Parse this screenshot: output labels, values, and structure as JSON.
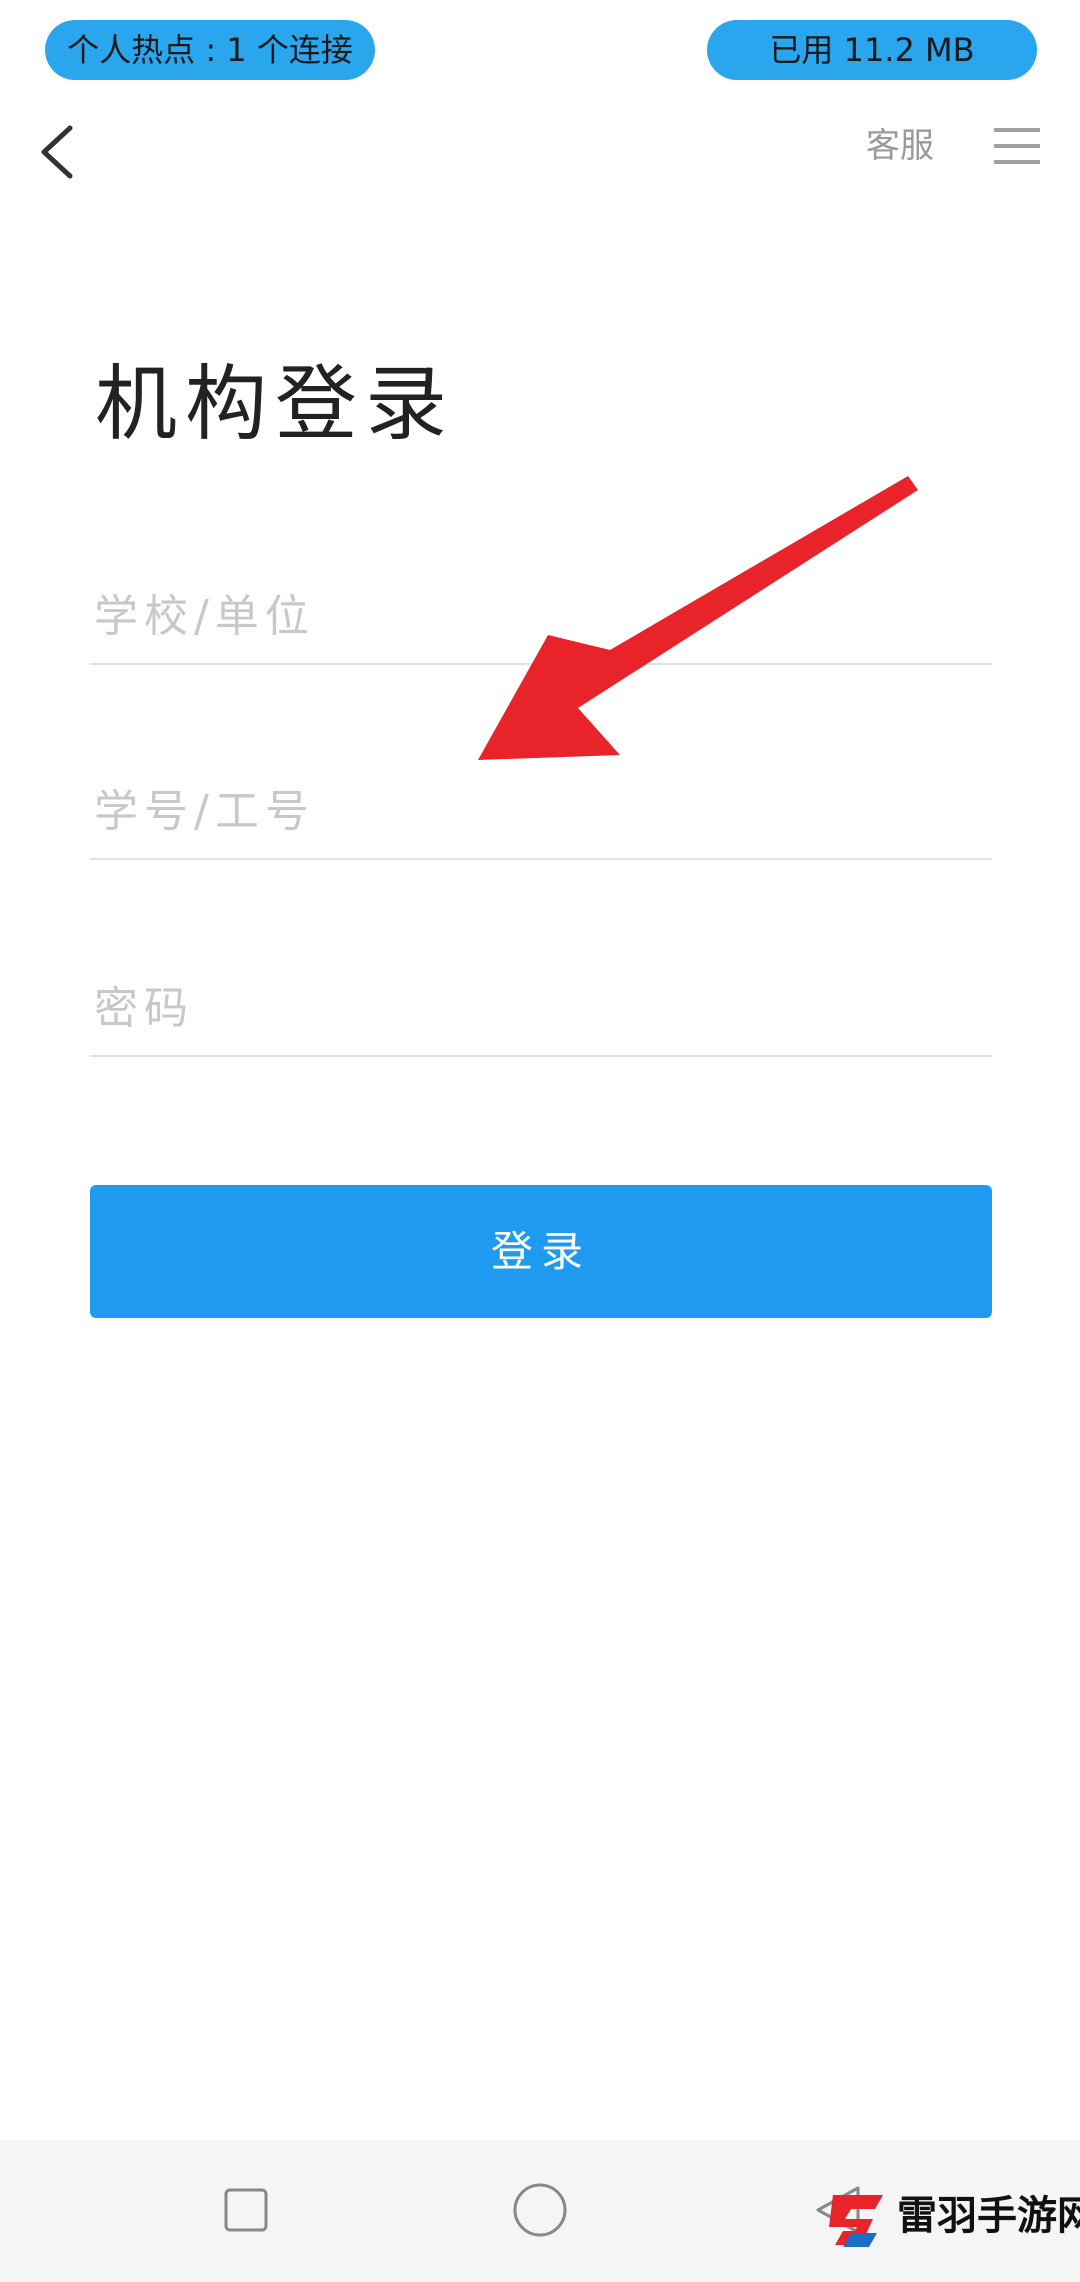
{
  "status_bar": {
    "hotspot_text": "个人热点 : 1 个连接",
    "data_used_text": "已用 11.2 MB"
  },
  "top_nav": {
    "back_icon": "chevron-left-icon",
    "service_label": "客服",
    "menu_icon": "hamburger-menu-icon"
  },
  "page": {
    "title": "机构登录"
  },
  "form": {
    "school_placeholder": "学校/单位",
    "id_placeholder": "学号/工号",
    "password_placeholder": "密码",
    "login_label": "登录"
  },
  "annotation": {
    "arrow_color": "#e8232a"
  },
  "colors": {
    "accent": "#1e9bf0",
    "pill": "#2aa6ee"
  },
  "system_nav": {
    "recent_icon": "square-icon",
    "home_icon": "circle-icon",
    "back_icon": "triangle-back-icon"
  },
  "watermark": {
    "text": "雷羽手游网"
  }
}
